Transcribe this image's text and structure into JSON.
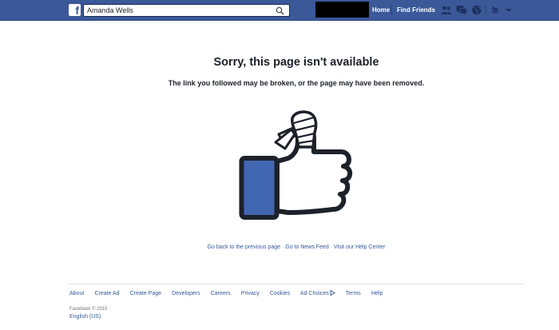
{
  "header": {
    "logo_letter": "f",
    "search": {
      "value": "Amanda Wells",
      "placeholder": ""
    },
    "nav": {
      "home": "Home",
      "find_friends": "Find Friends"
    },
    "icons": [
      "search-icon",
      "friend-requests-icon",
      "messages-icon",
      "notifications-icon",
      "privacy-shortcuts-icon",
      "account-settings-icon"
    ]
  },
  "main": {
    "title": "Sorry, this page isn't available",
    "subtitle": "The link you followed may be broken, or the page may have been removed.",
    "illustration": "bandaged-thumbs-up",
    "links": {
      "go_back": "Go back to the previous page",
      "news_feed": "Go to News Feed",
      "help_center": "Visit our Help Center",
      "separator": "·"
    }
  },
  "footer": {
    "links": [
      "About",
      "Create Ad",
      "Create Page",
      "Developers",
      "Careers",
      "Privacy",
      "Cookies",
      "Ad Choices",
      "Terms",
      "Help"
    ],
    "copyright": "Facebook © 2015",
    "language": "English (US)"
  },
  "colors": {
    "brand_blue": "#3b5998",
    "link_blue": "#365899",
    "text": "#1d2129",
    "thumb_fill": "#4267b2",
    "outline": "#1d2129"
  }
}
